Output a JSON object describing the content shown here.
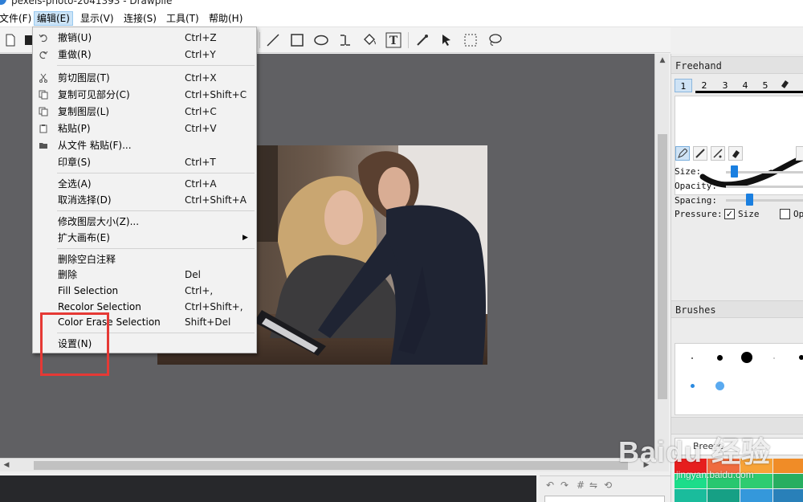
{
  "window": {
    "title": "pexels-photo-2041393 - Drawpile"
  },
  "menubar": [
    {
      "label": "文件(F)"
    },
    {
      "label": "编辑(E)"
    },
    {
      "label": "显示(V)"
    },
    {
      "label": "连接(S)"
    },
    {
      "label": "工具(T)"
    },
    {
      "label": "帮助(H)"
    }
  ],
  "toolbar": {
    "icons": [
      "new-document-icon",
      "open-icon",
      "line-icon",
      "rectangle-icon",
      "ellipse-icon",
      "bezier-icon",
      "fill-bucket-icon",
      "text-icon",
      "color-picker-icon",
      "selection-arrow-icon",
      "rect-select-icon",
      "lasso-icon"
    ]
  },
  "edit_menu": {
    "items": [
      {
        "label": "撤销(U)",
        "shortcut": "Ctrl+Z",
        "icon": "undo-icon"
      },
      {
        "label": "重做(R)",
        "shortcut": "Ctrl+Y",
        "icon": "redo-icon"
      },
      {
        "label": "剪切图层(T)",
        "shortcut": "Ctrl+X",
        "icon": "cut-icon"
      },
      {
        "label": "复制可见部分(C)",
        "shortcut": "Ctrl+Shift+C",
        "icon": "copy-icon"
      },
      {
        "label": "复制图层(L)",
        "shortcut": "Ctrl+C",
        "icon": "copy-icon"
      },
      {
        "label": "粘贴(P)",
        "shortcut": "Ctrl+V",
        "icon": "paste-icon"
      },
      {
        "label": "从文件 粘贴(F)...",
        "shortcut": "",
        "icon": "folder-icon"
      },
      {
        "label": "印章(S)",
        "shortcut": "Ctrl+T",
        "icon": ""
      },
      {
        "label": "全选(A)",
        "shortcut": "Ctrl+A",
        "icon": ""
      },
      {
        "label": "取消选择(D)",
        "shortcut": "Ctrl+Shift+A",
        "icon": ""
      },
      {
        "label": "修改图层大小(Z)...",
        "shortcut": "",
        "icon": ""
      },
      {
        "label": "扩大画布(E)",
        "shortcut": "",
        "icon": ""
      },
      {
        "label": "删除空白注释",
        "shortcut": "",
        "icon": ""
      },
      {
        "label": "删除",
        "shortcut": "Del",
        "icon": ""
      },
      {
        "label": "Fill Selection",
        "shortcut": "Ctrl+,",
        "icon": ""
      },
      {
        "label": "Recolor Selection",
        "shortcut": "Ctrl+Shift+,",
        "icon": ""
      },
      {
        "label": "Color Erase Selection",
        "shortcut": "Shift+Del",
        "icon": ""
      },
      {
        "label": "设置(N)",
        "shortcut": "",
        "icon": ""
      }
    ]
  },
  "right_panel": {
    "tool_title": "Freehand",
    "tabs": [
      "1",
      "2",
      "3",
      "4",
      "5"
    ],
    "size_label": "Size:",
    "opacity_label": "Opacity:",
    "spacing_label": "Spacing:",
    "pressure_label": "Pressure:",
    "pressure_size": "Size",
    "pressure_opacity": "Op",
    "size_value_fraction": 0.1,
    "spacing_value_fraction": 0.3,
    "brushes_title": "Brushes",
    "palette_name": "Breeze",
    "palette_colors": [
      "#e61e1e",
      "#ef6b3f",
      "#f7a338",
      "#f08c27",
      "#1cdd8a",
      "#28c76f",
      "#2ecc71",
      "#27ae60",
      "#1abc9c",
      "#16a085",
      "#3498db",
      "#2980b9"
    ]
  },
  "watermark": {
    "main": "Baidu 经验",
    "sub": "jingyan.baidu.com"
  },
  "colors": {
    "canvas_bg": "#606063",
    "menu_active": "#cce4f7",
    "annotation": "#e53935",
    "accent": "#1a7fe0"
  }
}
